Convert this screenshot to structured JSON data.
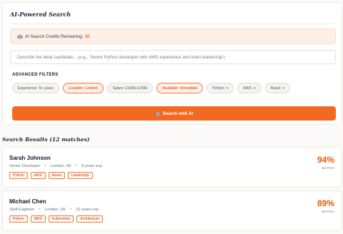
{
  "search_panel": {
    "title": "AI-Powered Search",
    "credits_icon": "robot-icon",
    "credits_label": "AI Search Credits Remaining:",
    "credits_value": "10",
    "description_placeholder": "Describe the ideal candidate... (e.g., 'Senior Python developer with AWS experience and team leadership')",
    "description_value": "",
    "filters_heading": "ADVANCED FILTERS",
    "filters": [
      {
        "label": "Experience: 5+ years",
        "active": false
      },
      {
        "label": "Location: London",
        "active": true
      },
      {
        "label": "Salary: £100k-£150k",
        "active": false
      },
      {
        "label": "Available: Immediate",
        "active": true
      },
      {
        "label": "Python",
        "active": false,
        "dropdown": true
      },
      {
        "label": "AWS",
        "active": false,
        "dropdown": true
      },
      {
        "label": "React",
        "active": false,
        "dropdown": true
      }
    ],
    "search_button_icon": "robot-icon",
    "search_button_label": "Search with AI",
    "accent_color": "#f26a21"
  },
  "results": {
    "heading": "Search Results (12 matches)",
    "items": [
      {
        "name": "Sarah Johnson",
        "role": "Senior Developer",
        "location": "London, UK",
        "experience": "8 years exp",
        "skills": [
          "Python",
          "AWS",
          "React",
          "Leadership"
        ],
        "match": "94%",
        "match_label": "MATCH"
      },
      {
        "name": "Michael Chen",
        "role": "Staff Engineer",
        "location": "London, UK",
        "experience": "10 years exp",
        "skills": [
          "Python",
          "AWS",
          "Kubernetes",
          "Architecture"
        ],
        "match": "89%",
        "match_label": "MATCH"
      }
    ]
  }
}
